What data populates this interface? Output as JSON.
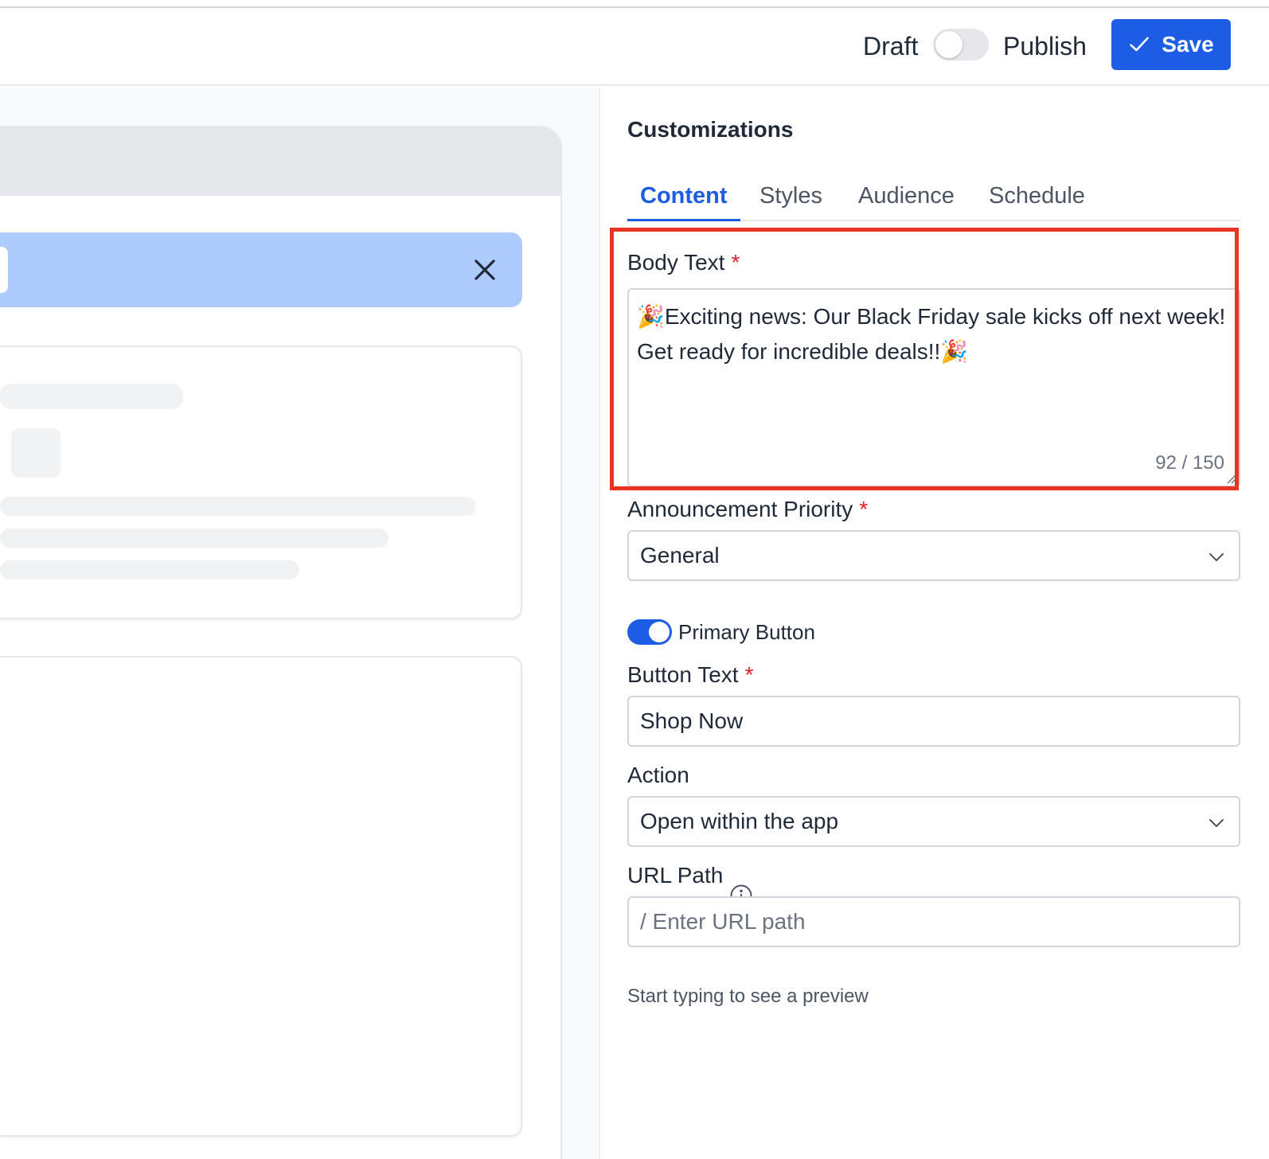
{
  "header": {
    "draft_label": "Draft",
    "publish_label": "Publish",
    "save_label": "Save",
    "status_is_published": false,
    "accent_color": "#1d5ce5"
  },
  "preview": {
    "banner_color": "#aecbfd",
    "close_icon": "close-icon"
  },
  "panel": {
    "title": "Customizations",
    "tabs": [
      {
        "label": "Content",
        "active": true
      },
      {
        "label": "Styles",
        "active": false
      },
      {
        "label": "Audience",
        "active": false
      },
      {
        "label": "Schedule",
        "active": false
      }
    ],
    "body_text": {
      "label": "Body Text",
      "required_mark": "*",
      "value": "🎉Exciting news: Our Black Friday sale kicks off next week! Get ready for incredible deals!!🎉",
      "char_count": "92 / 150"
    },
    "priority": {
      "label": "Announcement Priority",
      "required_mark": "*",
      "selected": "General"
    },
    "primary_button_toggle": {
      "label": "Primary Button",
      "enabled": true
    },
    "button_text": {
      "label": "Button Text",
      "required_mark": "*",
      "value": "Shop Now"
    },
    "action": {
      "label": "Action",
      "selected": "Open within the app"
    },
    "url_path": {
      "label": "URL Path",
      "placeholder": "/ Enter URL path",
      "helper": "Start typing to see a preview"
    }
  }
}
